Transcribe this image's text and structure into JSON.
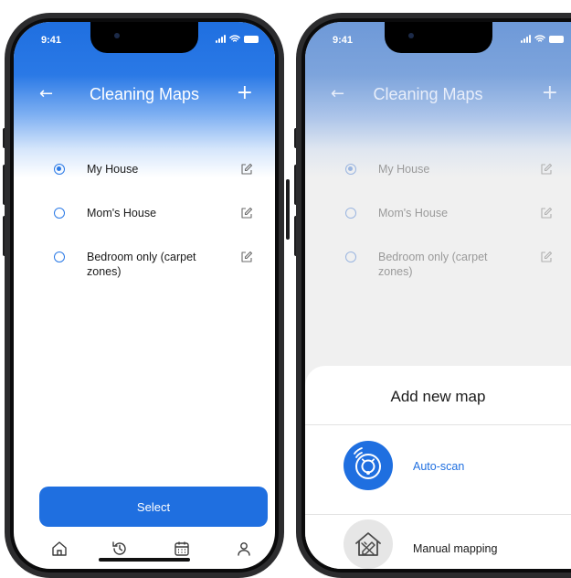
{
  "status": {
    "time": "9:41"
  },
  "header": {
    "title": "Cleaning Maps"
  },
  "maps": [
    {
      "label": "My House",
      "selected": true
    },
    {
      "label": "Mom's House",
      "selected": false
    },
    {
      "label": "Bedroom only (carpet zones)",
      "selected": false
    }
  ],
  "actions": {
    "select_label": "Select"
  },
  "tabbar": {
    "icons": [
      "home-icon",
      "history-icon",
      "calendar-icon",
      "profile-icon"
    ]
  },
  "sheet": {
    "title": "Add new map",
    "options": [
      {
        "label": "Auto-scan",
        "icon": "robot-vacuum-icon"
      },
      {
        "label": "Manual mapping",
        "icon": "house-ruler-icon"
      }
    ]
  },
  "colors": {
    "accent": "#1f6fe0",
    "sheet_bg": "#ffffff",
    "dim_bg": "#f0f0f0"
  }
}
